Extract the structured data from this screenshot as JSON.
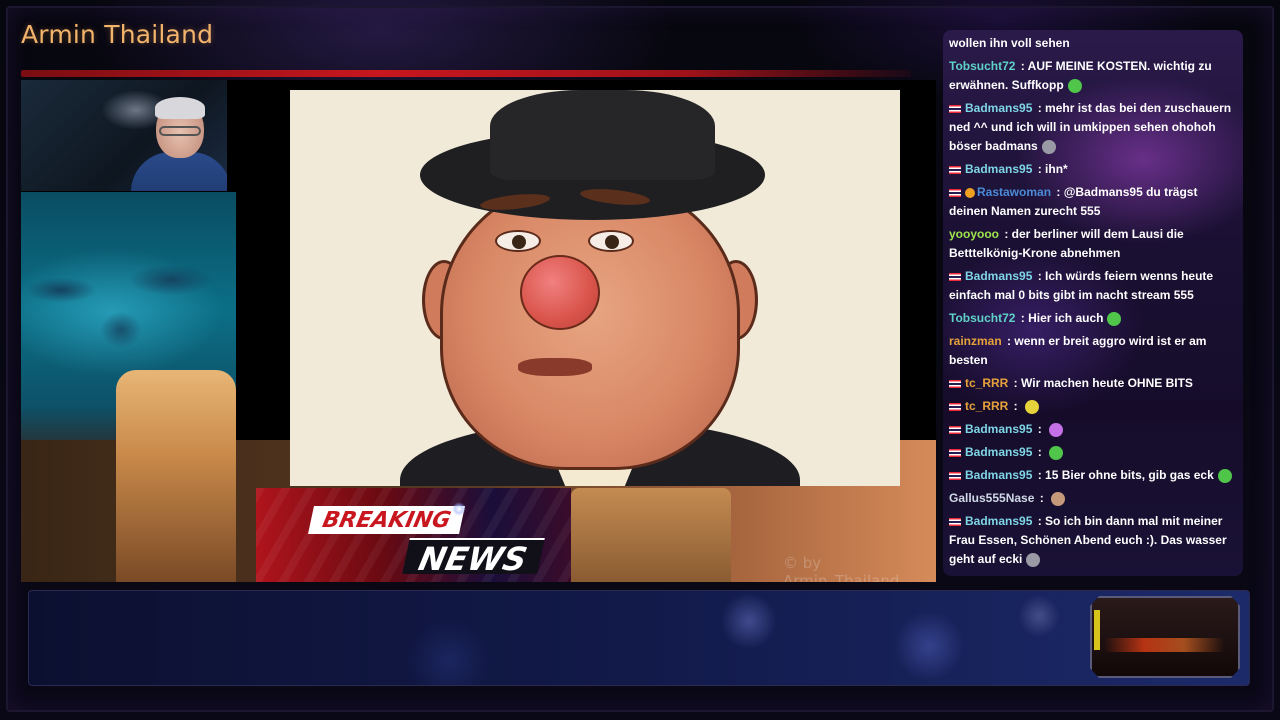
{
  "channel": {
    "title": "Armin Thailand"
  },
  "overlay": {
    "breaking": "BREAKING",
    "news": "NEWS",
    "watermark": "© by Armin_Thailand"
  },
  "chat": {
    "messages": [
      {
        "user": "",
        "user_color": "#ffffff",
        "flag": false,
        "text": "wollen ihn voll sehen",
        "emote": ""
      },
      {
        "user": "Tobsucht72",
        "user_color": "#5fd3c8",
        "flag": false,
        "text": "AUF MEINE KOSTEN. wichtig zu erwähnen. Suffkopp",
        "emote": "green-face-emote"
      },
      {
        "user": "Badmans95",
        "user_color": "#7fd6e6",
        "flag": true,
        "text": "mehr ist das bei den zuschauern ned ^^ und ich will in umkippen sehen ohohoh böser badmans",
        "emote": "grey-emote"
      },
      {
        "user": "Badmans95",
        "user_color": "#7fd6e6",
        "flag": true,
        "text": "ihn*",
        "emote": ""
      },
      {
        "user": "Rastawoman",
        "user_color": "#4a8ad6",
        "flag": true,
        "badge": true,
        "text": "@Badmans95 du trägst deinen Namen zurecht 555",
        "emote": ""
      },
      {
        "user": "yooyooo",
        "user_color": "#9ee64a",
        "flag": false,
        "text": "der berliner will dem Lausi die Betttelkönig-Krone abnehmen",
        "emote": ""
      },
      {
        "user": "Badmans95",
        "user_color": "#7fd6e6",
        "flag": true,
        "text": "Ich würds feiern wenns heute einfach mal 0 bits gibt im nacht stream 555",
        "emote": ""
      },
      {
        "user": "Tobsucht72",
        "user_color": "#5fd3c8",
        "flag": false,
        "text": "Hier ich auch",
        "emote": "green-face-emote"
      },
      {
        "user": "rainzman",
        "user_color": "#e6a23a",
        "flag": false,
        "text": "wenn er breit aggro wird ist er am besten",
        "emote": ""
      },
      {
        "user": "tc_RRR",
        "user_color": "#e6a23a",
        "flag": true,
        "text": "Wir machen heute OHNE BITS",
        "emote": ""
      },
      {
        "user": "tc_RRR",
        "user_color": "#e6a23a",
        "flag": true,
        "text": "",
        "emote": "yellow-emote"
      },
      {
        "user": "Badmans95",
        "user_color": "#7fd6e6",
        "flag": true,
        "text": "",
        "emote": "purple-emote"
      },
      {
        "user": "Badmans95",
        "user_color": "#7fd6e6",
        "flag": true,
        "text": "",
        "emote": "green-face-emote"
      },
      {
        "user": "Badmans95",
        "user_color": "#7fd6e6",
        "flag": true,
        "text": "15 Bier ohne bits, gib gas eck",
        "emote": "green-face-emote"
      },
      {
        "user": "Gallus555Nase",
        "user_color": "#cfd8e6",
        "flag": false,
        "text": "",
        "emote": "cat-emote"
      },
      {
        "user": "Badmans95",
        "user_color": "#7fd6e6",
        "flag": true,
        "text": "So ich bin dann mal mit meiner Frau Essen, Schönen Abend euch :). Das wasser geht auf ecki",
        "emote": "grey-emote"
      }
    ]
  },
  "colors": {
    "title": "#f2b36a",
    "accent_red": "#c8171f",
    "chat_bg": "#1a1032"
  }
}
